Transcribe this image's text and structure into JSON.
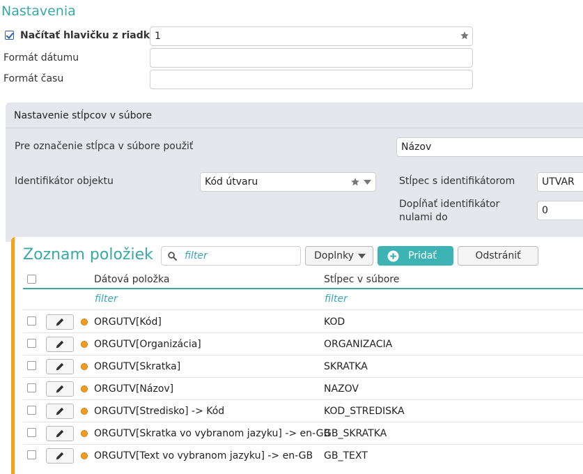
{
  "settings": {
    "title": "Nastavenia",
    "header_row": {
      "label": "Načítať hlavičku z riadku č.",
      "value": "1",
      "checked": true
    },
    "date_format": {
      "label": "Formát dátumu",
      "value": ""
    },
    "time_format": {
      "label": "Formát času",
      "value": ""
    }
  },
  "columns_panel": {
    "title": "Nastavenie stĺpcov v súbore",
    "use_for_column": {
      "label": "Pre označenie stĺpca v súbore použiť",
      "value": "Názov"
    },
    "object_id": {
      "label": "Identifikátor objektu",
      "value": "Kód útvaru"
    },
    "id_column": {
      "label": "Stĺpec s identifikátorom",
      "value": "UTVAR"
    },
    "pad_zeros": {
      "label": "Dopĺňať identifikátor nulami do",
      "value": "0"
    }
  },
  "list": {
    "title": "Zoznam položiek",
    "filter_placeholder": "filter",
    "addons_label": "Doplnky",
    "add_label": "Pridať",
    "remove_label": "Odstrániť",
    "headers": {
      "data_item": "Dátová položka",
      "file_column": "Stĺpec v súbore"
    },
    "column_filter_placeholder": "filter",
    "rows": [
      {
        "item": "ORGUTV[Kód]",
        "column": "KOD"
      },
      {
        "item": "ORGUTV[Organizácia]",
        "column": "ORGANIZACIA"
      },
      {
        "item": "ORGUTV[Skratka]",
        "column": "SKRATKA"
      },
      {
        "item": "ORGUTV[Názov]",
        "column": "NAZOV"
      },
      {
        "item": "ORGUTV[Stredisko] -> Kód",
        "column": "KOD_STREDISKA"
      },
      {
        "item": "ORGUTV[Skratka vo vybranom jazyku] -> en-GB",
        "column": "GB_SKRATKA"
      },
      {
        "item": "ORGUTV[Text vo vybranom jazyku] -> en-GB",
        "column": "GB_TEXT"
      }
    ]
  },
  "colors": {
    "accent": "#39a9a5",
    "list_border": "#f5a31a",
    "status_dot": "#f29d1b",
    "primary_button": "#3db3b4"
  },
  "icons": [
    "star-icon",
    "chevron-down-icon",
    "search-icon",
    "plus-circle-icon",
    "pencil-icon",
    "status-dot-icon"
  ]
}
